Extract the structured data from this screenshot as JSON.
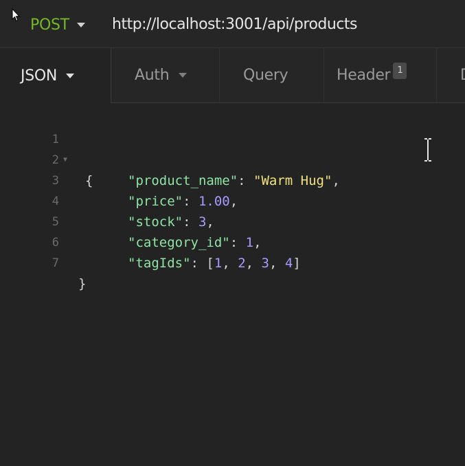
{
  "request": {
    "method": "POST",
    "url": "http://localhost:3001/api/products"
  },
  "tabs": {
    "body_format": "JSON",
    "auth": "Auth",
    "query": "Query",
    "header": "Header",
    "header_count": "1",
    "more": "D"
  },
  "editor": {
    "lines": [
      {
        "num": "1",
        "open": "{"
      },
      {
        "num": "2",
        "key": "\"product_name\"",
        "colon": ": ",
        "str": "\"Warm Hug\"",
        "comma": ","
      },
      {
        "num": "3",
        "key": "\"price\"",
        "colon": ": ",
        "val": "1.00",
        "comma": ","
      },
      {
        "num": "4",
        "key": "\"stock\"",
        "colon": ": ",
        "val": "3",
        "comma": ","
      },
      {
        "num": "5",
        "key": "\"category_id\"",
        "colon": ": ",
        "val": "1",
        "comma": ","
      },
      {
        "num": "6",
        "key": "\"tagIds\"",
        "colon": ": ",
        "arr_open": "[",
        "a1": "1",
        "a2": "2",
        "a3": "3",
        "a4": "4",
        "sep": ", ",
        "arr_close": "]"
      },
      {
        "num": "7",
        "close": "}"
      }
    ]
  },
  "colors": {
    "method": "#75ba24",
    "key": "#8ee4a4",
    "string": "#f2e27d",
    "number": "#a59cff",
    "background": "#232323"
  },
  "icons": {
    "method_dropdown": "chevron-down-icon",
    "body_dropdown": "chevron-down-icon",
    "auth_dropdown": "chevron-down-icon",
    "fold": "fold-arrow-icon",
    "mouse": "mouse-arrow-icon",
    "text_cursor": "i-beam-cursor-icon"
  }
}
